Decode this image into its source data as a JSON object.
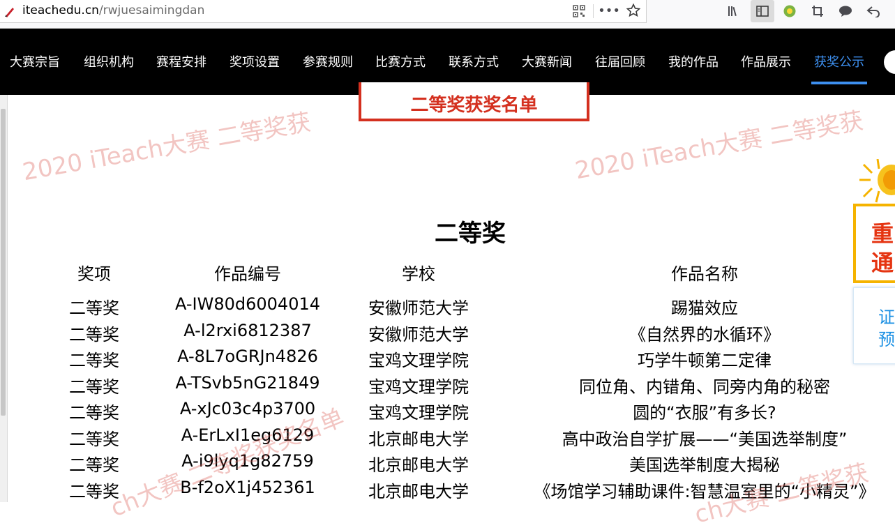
{
  "browser": {
    "url_domain": "iteachedu.cn",
    "url_path": "/rwjuesaimingdan"
  },
  "nav": {
    "items": [
      "大赛宗旨",
      "组织机构",
      "赛程安排",
      "奖项设置",
      "参赛规则",
      "比赛方式",
      "联系方式",
      "大赛新闻",
      "往届回顾",
      "我的作品",
      "作品展示",
      "获奖公示"
    ],
    "active": "获奖公示",
    "active_color": "#3d8fef"
  },
  "banner": {
    "title": "二等奖获奖名单",
    "accent_color": "#d4301f"
  },
  "watermarks": {
    "top_left": "2020 iTeach大赛 二等奖获",
    "top_right": "2020 iTeach大赛 二等奖获",
    "bottom_left": "ch大赛 二等奖获奖名单",
    "bottom_right": "ch大赛 二等奖获"
  },
  "section": {
    "title": "二等奖"
  },
  "table": {
    "headers": [
      "奖项",
      "作品编号",
      "学校",
      "作品名称"
    ],
    "rows": [
      [
        "二等奖",
        "A-IW80d6004014",
        "安徽师范大学",
        "踢猫效应"
      ],
      [
        "二等奖",
        "A-l2rxi6812387",
        "安徽师范大学",
        "《自然界的水循环》"
      ],
      [
        "二等奖",
        "A-8L7oGRJn4826",
        "宝鸡文理学院",
        "巧学牛顿第二定律"
      ],
      [
        "二等奖",
        "A-TSvb5nG21849",
        "宝鸡文理学院",
        "同位角、内错角、同旁内角的秘密"
      ],
      [
        "二等奖",
        "A-xJc03c4p3700",
        "宝鸡文理学院",
        "圆的“衣服”有多长?"
      ],
      [
        "二等奖",
        "A-ErLxI1eg6129",
        "北京邮电大学",
        "高中政治自学扩展——“美国选举制度”"
      ],
      [
        "二等奖",
        "A-i9lyq1g82759",
        "北京邮电大学",
        "美国选举制度大揭秘"
      ],
      [
        "二等奖",
        "B-f2oX1j452361",
        "北京邮电大学",
        "《场馆学习辅助课件:智慧温室里的“小精灵”》"
      ]
    ]
  },
  "side_promo": {
    "line1": "重",
    "line2": "通",
    "border_color": "#f5b300"
  },
  "side_cert": {
    "line1": "证",
    "line2": "预"
  }
}
